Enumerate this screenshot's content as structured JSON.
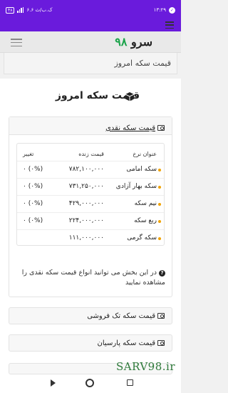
{
  "status_bar": {
    "time": "۱۳:۲۹",
    "speed": "۶.۶ ک.ب/ث",
    "battery": "۴۸"
  },
  "header": {
    "logo_text": "سرو",
    "logo_number": "۹۸"
  },
  "breadcrumb": "قیمت سکه امروز",
  "page": {
    "title": "قیمت سکه امروز"
  },
  "cash_card": {
    "title": "قیمت سکه نقدی",
    "columns": [
      "عنوان نرخ",
      "قیمت زنده",
      "تغییر"
    ],
    "rows": [
      {
        "name": "سکه امامی",
        "price": "۷۸۲,۱۰۰,۰۰۰",
        "change": "۰ (۰%)"
      },
      {
        "name": "سکه بهار آزادی",
        "price": "۷۳۱,۲۵۰,۰۰۰",
        "change": "۰ (۰%)"
      },
      {
        "name": "نیم سکه",
        "price": "۴۲۹,۰۰۰,۰۰۰",
        "change": "۰ (۰%)"
      },
      {
        "name": "ربع سکه",
        "price": "۲۲۴,۰۰۰,۰۰۰",
        "change": "۰ (۰%)"
      },
      {
        "name": "سکه گرمی",
        "price": "۱۱۱,۰۰۰,۰۰۰",
        "change": ""
      }
    ],
    "note": "در این بخش می توانید انواع قیمت سکه نقدی را مشاهده نمایید"
  },
  "sections": [
    {
      "title": "قیمت سکه تک فروشی"
    },
    {
      "title": "قیمت سکه پارسیان"
    }
  ],
  "watermark": "SARV98.ir",
  "colors": {
    "statusbar": "#6a1bdc",
    "logo_number": "#1aa34a",
    "dot": "#f0a202"
  }
}
